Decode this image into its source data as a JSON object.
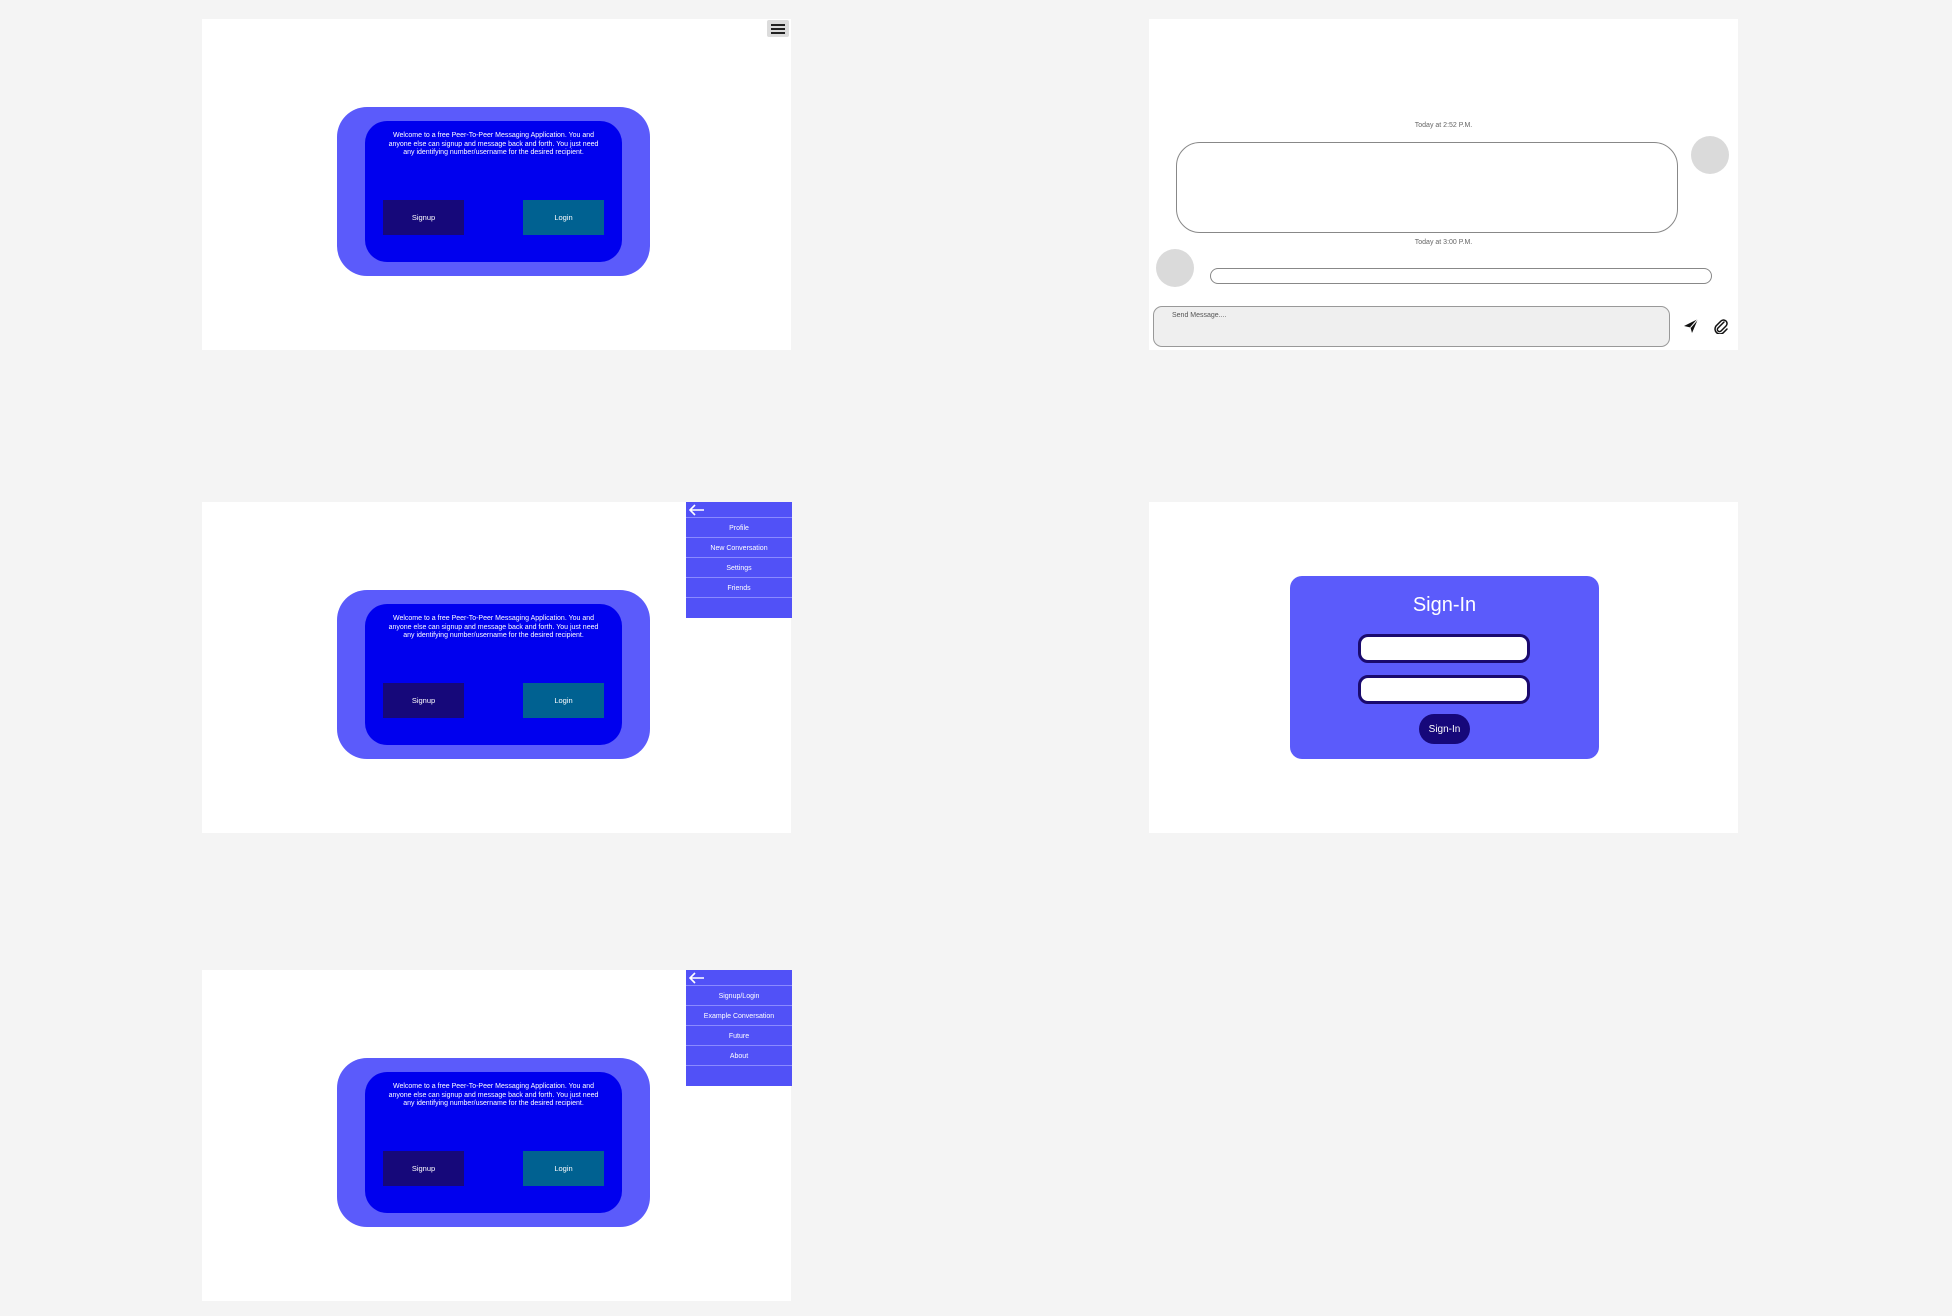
{
  "home": {
    "welcome_text": "Welcome to a free Peer-To-Peer Messaging Application. You and anyone else can signup and message back and forth. You just need any identifying number/username for the desired recipient.",
    "signup_label": "Signup",
    "login_label": "Login"
  },
  "menu_logged_in": {
    "items": [
      "Profile",
      "New Conversation",
      "Settings",
      "Friends"
    ]
  },
  "menu_guest": {
    "items": [
      "Signup/Login",
      "Example Conversation",
      "Future",
      "About"
    ]
  },
  "chat": {
    "timestamp_1": "Today at 2:52 P.M.",
    "timestamp_2": "Today at 3:00 P.M.",
    "input_placeholder": "Send Message...."
  },
  "signin": {
    "title": "Sign-In",
    "button_label": "Sign-In"
  },
  "colors": {
    "page_bg": "#f4f4f4",
    "accent": "#5b5bfb",
    "primary_blue": "#0000ee",
    "signup_btn": "#16087a",
    "login_btn": "#006191"
  },
  "icons": {
    "menu": "hamburger-icon",
    "back": "arrow-left-icon",
    "send": "send-icon",
    "attach": "paperclip-icon"
  }
}
